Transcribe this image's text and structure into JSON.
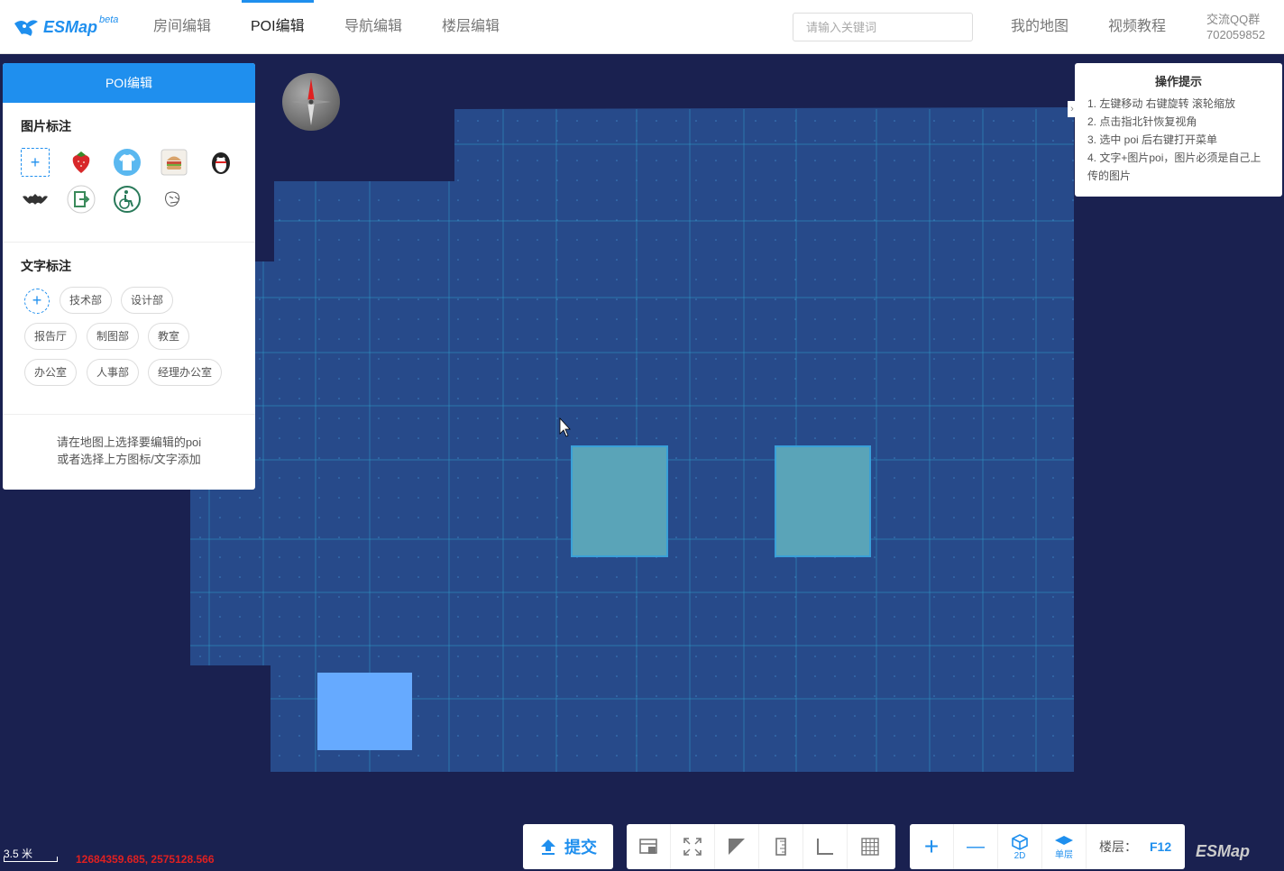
{
  "app": {
    "logo_text": "ESMap",
    "logo_suffix": "beta"
  },
  "nav": {
    "tabs": [
      {
        "label": "房间编辑"
      },
      {
        "label": "POI编辑"
      },
      {
        "label": "导航编辑"
      },
      {
        "label": "楼层编辑"
      }
    ],
    "active_tab": "POI编辑"
  },
  "search": {
    "placeholder": "请输入关键词",
    "value": ""
  },
  "header_links": {
    "my_map": "我的地图",
    "tutorial": "视频教程",
    "qq_label": "交流QQ群",
    "qq_number": "702059852"
  },
  "panel": {
    "title": "POI编辑",
    "image_section_title": "图片标注",
    "image_icons": [
      "add-icon",
      "strawberry-icon",
      "tshirt-icon",
      "burger-icon",
      "penguin-icon",
      "bat-icon",
      "exit-icon",
      "wheelchair-icon",
      "sketch-icon"
    ],
    "add_symbol": "+",
    "text_section_title": "文字标注",
    "text_tags": [
      "技术部",
      "设计部",
      "报告厅",
      "制图部",
      "教室",
      "办公室",
      "人事部",
      "经理办公室"
    ],
    "hint_line1": "请在地图上选择要编辑的poi",
    "hint_line2": "或者选择上方图标/文字添加"
  },
  "tips": {
    "title": "操作提示",
    "items": [
      "1. 左键移动 右键旋转 滚轮缩放",
      "2. 点击指北针恢复视角",
      "3. 选中 poi 后右键打开菜单",
      "4. 文字+图片poi，图片必须是自己上传的图片"
    ],
    "collapse_symbol": "›"
  },
  "toolbar": {
    "submit_label": "提交",
    "tools": [
      "select-box-icon",
      "fullscreen-icon",
      "triangle-icon",
      "ruler-icon",
      "angle-icon",
      "grid-icon"
    ],
    "zoom_in_symbol": "+",
    "zoom_out_symbol": "—",
    "view_2d_label": "2D",
    "single_floor_label": "单层",
    "floor_label": "楼层：",
    "floor_value": "F12"
  },
  "map": {
    "scale_label": "3.5 米",
    "coordinates": "12684359.685, 2575128.566",
    "brand": "ESMap",
    "colors": {
      "background": "#1a2150",
      "floor": "#274a8a",
      "room": "#5aa4b8",
      "selected": "#66aaff"
    }
  }
}
